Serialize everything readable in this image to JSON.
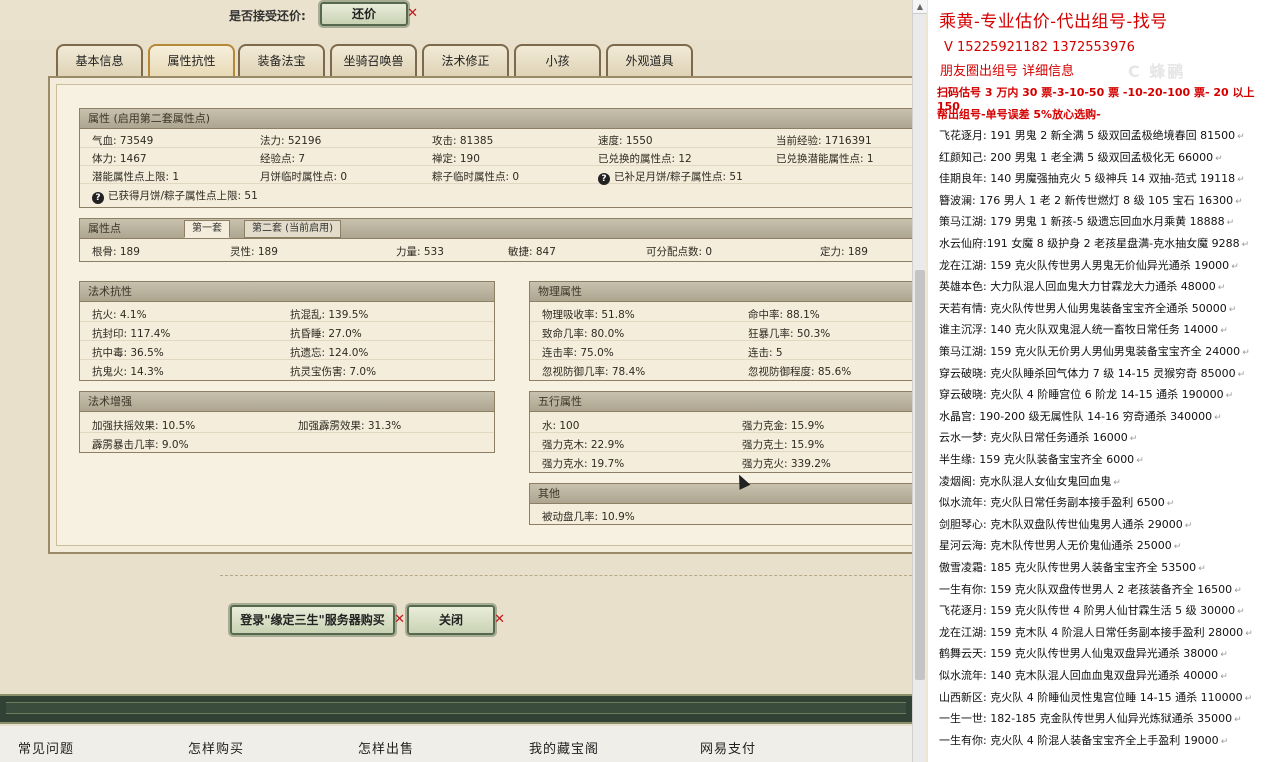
{
  "top": {
    "question": "是否接受还价:",
    "counter_label": "还价",
    "x_mark": "✕"
  },
  "tabs": [
    "基本信息",
    "属性抗性",
    "装备法宝",
    "坐骑召唤兽",
    "法术修正",
    "小孩",
    "外观道具"
  ],
  "attr": {
    "header": "属性 (启用第二套属性点)",
    "cells": [
      "气血: 73549",
      "法力: 52196",
      "攻击: 81385",
      "速度: 1550",
      "当前经验: 1716391",
      "体力: 1467",
      "经验点: 7",
      "禅定: 190",
      "已兑换的属性点: 12",
      "已兑换潜能属性点: 1",
      "潜能属性点上限: 1",
      "月饼临时属性点: 0",
      "粽子临时属性点: 0",
      "已补足月饼/粽子属性点: 51"
    ],
    "note": "已获得月饼/粽子属性点上限: 51",
    "q": "?"
  },
  "points": {
    "header": "属性点",
    "tab1": "第一套",
    "tab2": "第二套 (当前启用)",
    "cells": [
      "根骨: 189",
      "灵性: 189",
      "力量: 533",
      "敏捷: 847",
      "可分配点数: 0",
      "定力: 189"
    ]
  },
  "resist": {
    "header": "法术抗性",
    "cells": [
      "抗火: 4.1%",
      "抗混乱: 139.5%",
      "抗封印: 117.4%",
      "抗昏睡: 27.0%",
      "抗中毒: 36.5%",
      "抗遗忘: 124.0%",
      "抗鬼火: 14.3%",
      "抗灵宝伤害: 7.0%"
    ]
  },
  "boost": {
    "header": "法术增强",
    "cells": [
      "加强扶摇效果: 10.5%",
      "加强霹雳效果: 31.3%",
      "霹雳暴击几率: 9.0%"
    ]
  },
  "physical": {
    "header": "物理属性",
    "cells": [
      "物理吸收率: 51.8%",
      "命中率: 88.1%",
      "致命几率: 80.0%",
      "狂暴几率: 50.3%",
      "连击率: 75.0%",
      "连击: 5",
      "忽视防御几率: 78.4%",
      "忽视防御程度: 85.6%"
    ]
  },
  "elements": {
    "header": "五行属性",
    "cells": [
      "水: 100",
      "强力克金: 15.9%",
      "强力克木: 22.9%",
      "强力克土: 15.9%",
      "强力克水: 19.7%",
      "强力克火: 339.2%"
    ]
  },
  "other": {
    "header": "其他",
    "cells": [
      "被动盘几率: 10.9%"
    ]
  },
  "actions": {
    "login": "登录\"缘定三生\"服务器购买",
    "close": "关闭"
  },
  "footer": [
    "常见问题",
    "怎样购买",
    "怎样出售",
    "我的藏宝阁",
    "网易支付"
  ],
  "right": {
    "title": "乘黄-专业估价-代出组号-找号",
    "phone": "V 15225921182   1372553976",
    "circle": "朋友圈出组号   详细信息",
    "watermark": "C 蜂鹂",
    "scan": "扫码估号 3 万内 30 票-3-10-50 票  -10-20-100 票- 20 以上 150",
    "team": "帮出组号-单号误差 5%放心选购-",
    "pm": "↵",
    "listings": [
      "飞花逐月: 191 男鬼 2 新全满 5 级双回孟极绝境春回 81500",
      "红颜知己: 200 男鬼 1 老全满 5 级双回孟极化无 66000",
      "佳期良年: 140 男魔强抽克火 5 级神兵 14 双抽-范式 19118",
      "簪波澜: 176 男人 1 老 2 新传世燃灯 8 级 105 宝石 16300",
      "策马江湖: 179 男鬼 1 新孩-5 级遗忘回血水月乘黄 18888",
      "水云仙府:191 女魔 8 级护身 2 老孩星盘满-克水抽女魔 9288",
      "龙在江湖: 159 克火队传世男人男鬼无价仙异光通杀 19000",
      "英雄本色: 大力队混人回血鬼大力甘霖龙大力通杀 48000",
      "天若有情: 克火队传世男人仙男鬼装备宝宝齐全通杀 50000",
      "谁主沉浮: 140 克火队双鬼混人统一畜牧日常任务 14000",
      "策马江湖: 159 克火队无价男人男仙男鬼装备宝宝齐全 24000",
      "穿云破晓: 克火队睡杀回气体力 7 级 14-15 灵猴穷奇 85000",
      "穿云破晓: 克火队 4 阶睡宫位 6 阶龙 14-15 通杀 190000",
      "水晶宫: 190-200 级无属性队 14-16 穷奇通杀 340000",
      "云水一梦: 克火队日常任务通杀 16000",
      "半生缘: 159 克火队装备宝宝齐全 6000",
      "凌烟阁: 克水队混人女仙女鬼回血鬼",
      "似水流年: 克火队日常任务副本接手盈利 6500",
      "剑胆琴心: 克木队双盘队传世仙鬼男人通杀 29000",
      "星河云海: 克木队传世男人无价鬼仙通杀 25000",
      "傲雪凌霜: 185 克火队传世男人装备宝宝齐全 53500",
      "一生有你: 159 克火队双盘传世男人 2 老孩装备齐全 16500",
      "飞花逐月: 159 克火队传世 4 阶男人仙甘霖生活 5 级 30000",
      "龙在江湖: 159 克木队 4 阶混人日常任务副本接手盈利 28000",
      "鹤舞云天: 159 克火队传世男人仙鬼双盘异光通杀 38000",
      "似水流年: 140 克木队混人回血血鬼双盘异光通杀 40000",
      "山西新区: 克火队 4 阶睡仙灵性鬼宫位睡 14-15 通杀 110000",
      "一生一世: 182-185 克金队传世男人仙异光炼狱通杀 35000",
      "一生有你: 克火队 4 阶混人装备宝宝齐全上手盈利 19000"
    ]
  },
  "colors": {
    "accent_red": "#d40000",
    "frame_green": "#314234"
  }
}
